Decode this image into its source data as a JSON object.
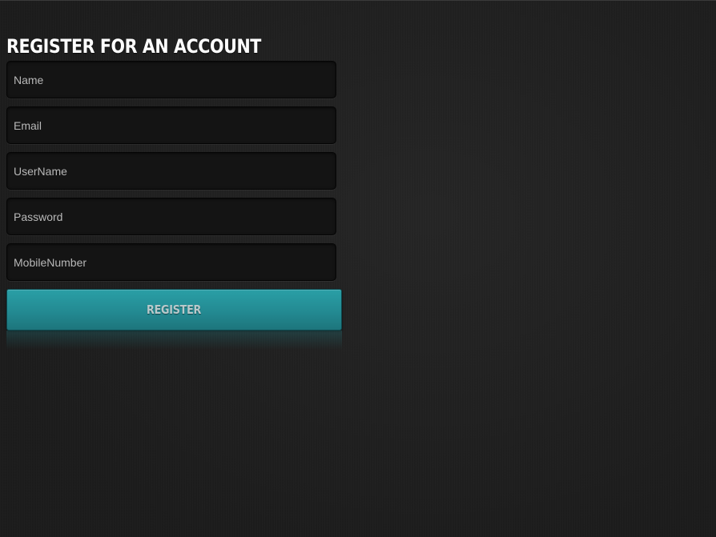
{
  "form": {
    "title": "REGISTER FOR AN ACCOUNT",
    "fields": [
      {
        "placeholder": "Name"
      },
      {
        "placeholder": "Email"
      },
      {
        "placeholder": "UserName"
      },
      {
        "placeholder": "Password"
      },
      {
        "placeholder": "MobileNumber"
      }
    ],
    "submit_label": "REGISTER"
  },
  "colors": {
    "background": "#1f1f1f",
    "field_background": "#141414",
    "button_accent": "#238a92",
    "title_text": "#ffffff"
  }
}
